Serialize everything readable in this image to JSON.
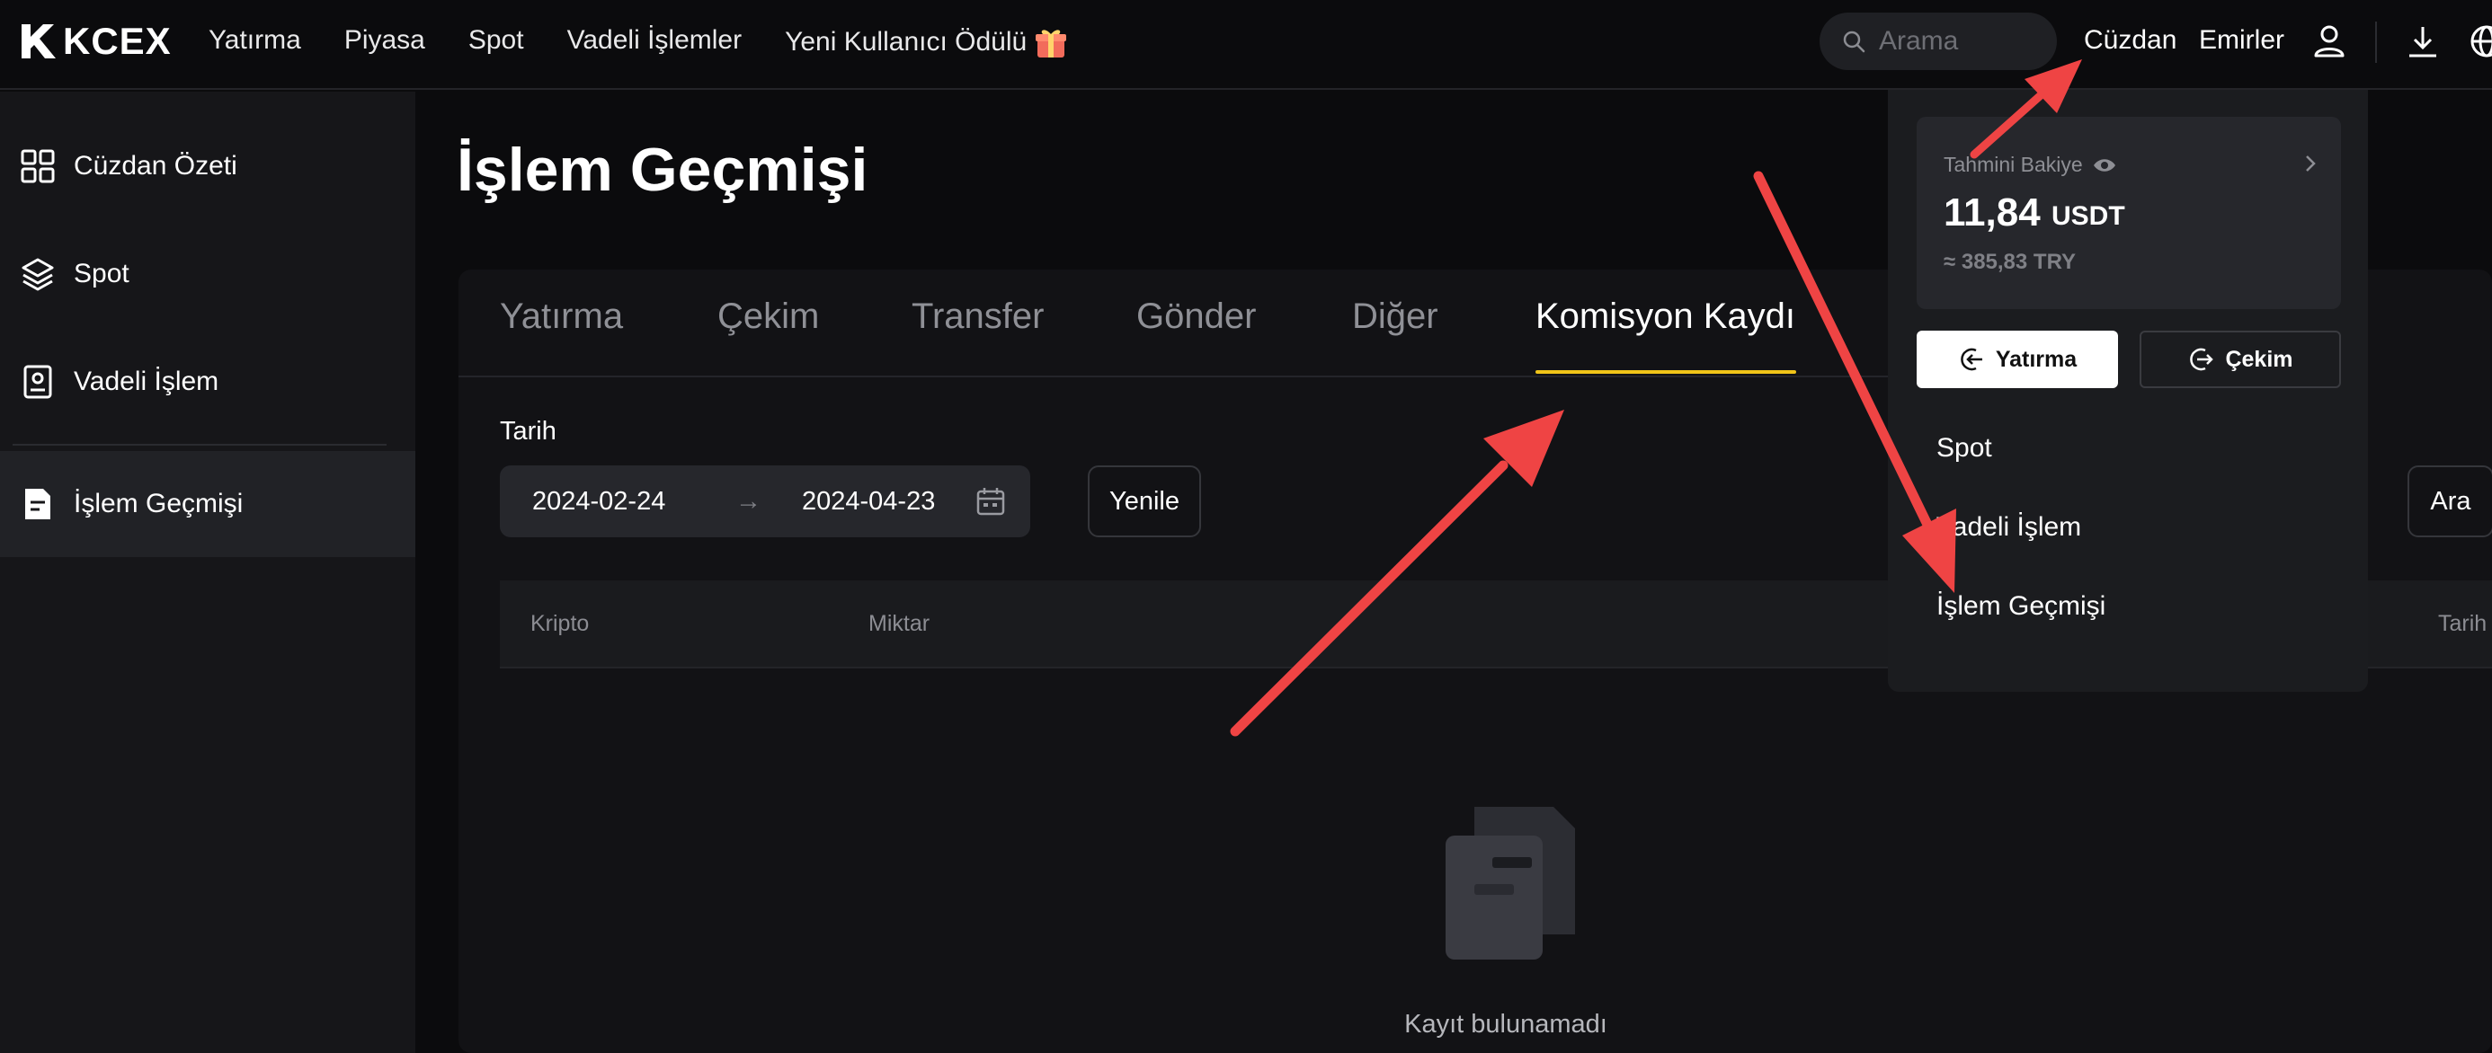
{
  "topbar": {
    "logo_text": "KCEX",
    "nav": [
      "Yatırma",
      "Piyasa",
      "Spot",
      "Vadeli İşlemler",
      "Yeni Kullanıcı Ödülü"
    ],
    "gift_icon": "gift-icon",
    "search_placeholder": "Arama",
    "wallet": "Cüzdan",
    "orders": "Emirler"
  },
  "sidebar": {
    "items": [
      {
        "label": "Cüzdan Özeti",
        "icon": "grid-icon"
      },
      {
        "label": "Spot",
        "icon": "layers-icon"
      },
      {
        "label": "Vadeli İşlem",
        "icon": "contract-icon"
      },
      {
        "label": "İşlem Geçmişi",
        "icon": "document-icon",
        "active": true
      }
    ]
  },
  "main": {
    "title": "İşlem Geçmişi",
    "tabs": [
      "Yatırma",
      "Çekim",
      "Transfer",
      "Gönder",
      "Diğer",
      "Komisyon Kaydı"
    ],
    "active_tab": "Komisyon Kaydı",
    "date_label": "Tarih",
    "date_from": "2024-02-24",
    "date_to": "2024-04-23",
    "date_arrow": "→",
    "refresh": "Yenile",
    "search_btn": "Ara",
    "columns": [
      "Kripto",
      "Miktar",
      "Tarih"
    ],
    "empty": "Kayıt bulunamadı"
  },
  "wallet_dropdown": {
    "balance_label": "Tahmini Bakiye",
    "balance_amount": "11,84",
    "balance_unit": "USDT",
    "balance_fiat": "≈ 385,83 TRY",
    "deposit": "Yatırma",
    "withdraw": "Çekim",
    "items": [
      "Spot",
      "Vadeli İşlem",
      "İşlem Geçmişi"
    ]
  },
  "colors": {
    "accent": "#f0c419",
    "annotation_arrow": "#ef4444",
    "background": "#0b0b0d",
    "sidebar": "#161619"
  }
}
